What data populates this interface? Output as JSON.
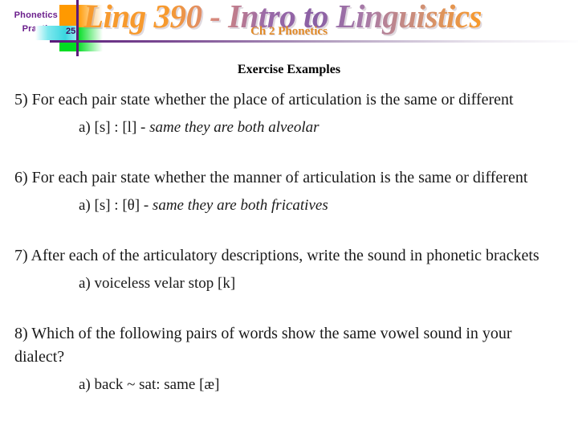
{
  "header": {
    "kicker_line1": "Phonetics",
    "kicker_line2": "Practice",
    "page_number": "25",
    "title": "Ling 390 - Intro to Linguistics",
    "subtitle": "Ch 2 Phonetics",
    "colors": {
      "purple": "#5b1a7a",
      "orange": "#ff9900",
      "green": "#00dd22",
      "cyan": "#3ad7e0",
      "title_orange": "#f79a2e",
      "title_purple": "#8a5fa4",
      "subtitle_orange": "#e08a27"
    }
  },
  "main": {
    "heading": "Exercise Examples",
    "items": [
      {
        "question": "5) For each pair state whether the place of articulation is the same or different",
        "answer_prefix": "a) [s] : [l] - ",
        "answer_italic": "same they are both alveolar"
      },
      {
        "question": "6) For each pair state whether the manner of articulation is the same or different",
        "answer_prefix": "a) [s] : [θ] - ",
        "answer_italic": "same they are both fricatives"
      },
      {
        "question": "7) After each of the articulatory descriptions, write the sound in phonetic brackets",
        "answer_prefix": "a) voiceless velar stop [k]",
        "answer_italic": ""
      },
      {
        "question": "8) Which of the following pairs of words show the same vowel sound in your dialect?",
        "answer_prefix": "a) back ~ sat:  same [æ]",
        "answer_italic": ""
      }
    ]
  }
}
